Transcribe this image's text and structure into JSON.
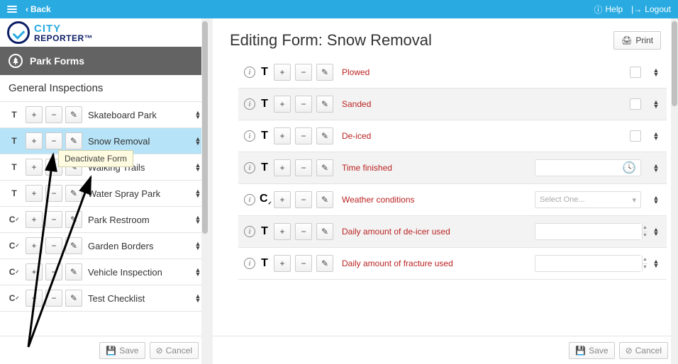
{
  "topbar": {
    "back": "Back",
    "help": "Help",
    "logout": "Logout"
  },
  "logo": {
    "line1": "CITY",
    "line2": "REPORTER™"
  },
  "sidebar": {
    "section": "Park Forms",
    "category": "General Inspections",
    "items": [
      {
        "type": "T",
        "name": "Skateboard Park"
      },
      {
        "type": "T",
        "name": "Snow Removal",
        "selected": true
      },
      {
        "type": "T",
        "name": "Walking Trails"
      },
      {
        "type": "T",
        "name": "Water Spray Park"
      },
      {
        "type": "C",
        "name": "Park Restroom"
      },
      {
        "type": "C",
        "name": "Garden Borders"
      },
      {
        "type": "C",
        "name": "Vehicle Inspection"
      },
      {
        "type": "C",
        "name": "Test Checklist"
      }
    ],
    "tooltip": "Deactivate Form"
  },
  "rightpane": {
    "title": "Editing Form: Snow Removal",
    "print": "Print",
    "fields": [
      {
        "type": "T",
        "label": "Plowed",
        "widget": "checkbox"
      },
      {
        "type": "T",
        "label": "Sanded",
        "widget": "checkbox",
        "alt": true
      },
      {
        "type": "T",
        "label": "De-iced",
        "widget": "checkbox"
      },
      {
        "type": "T",
        "label": "Time finished",
        "widget": "time",
        "alt": true
      },
      {
        "type": "C",
        "label": "Weather conditions",
        "widget": "select",
        "placeholder": "Select One..."
      },
      {
        "type": "T",
        "label": "Daily amount of de-icer used",
        "widget": "spinner",
        "alt": true
      },
      {
        "type": "T",
        "label": "Daily amount of fracture used",
        "widget": "spinner"
      }
    ]
  },
  "footer": {
    "save": "Save",
    "cancel": "Cancel"
  }
}
